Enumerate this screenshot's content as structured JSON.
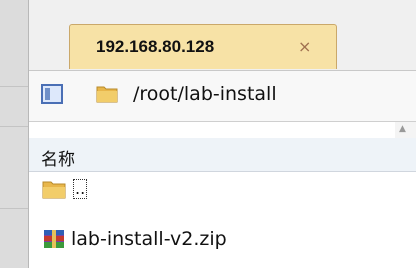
{
  "tab": {
    "title": "192.168.80.128",
    "close_glyph": "×"
  },
  "path_bar": {
    "path": "/root/lab-install",
    "panel_icon": "panel-toggle-icon",
    "folder_icon": "folder-icon"
  },
  "list": {
    "column_header": "名称",
    "items": [
      {
        "label": "..",
        "icon": "folder-icon"
      },
      {
        "label": "lab-install-v2.zip",
        "icon": "archive-icon"
      }
    ]
  },
  "colors": {
    "tab_bg": "#f7e2a6",
    "header_bg": "#eef3f8",
    "folder": "#e8b64a"
  }
}
